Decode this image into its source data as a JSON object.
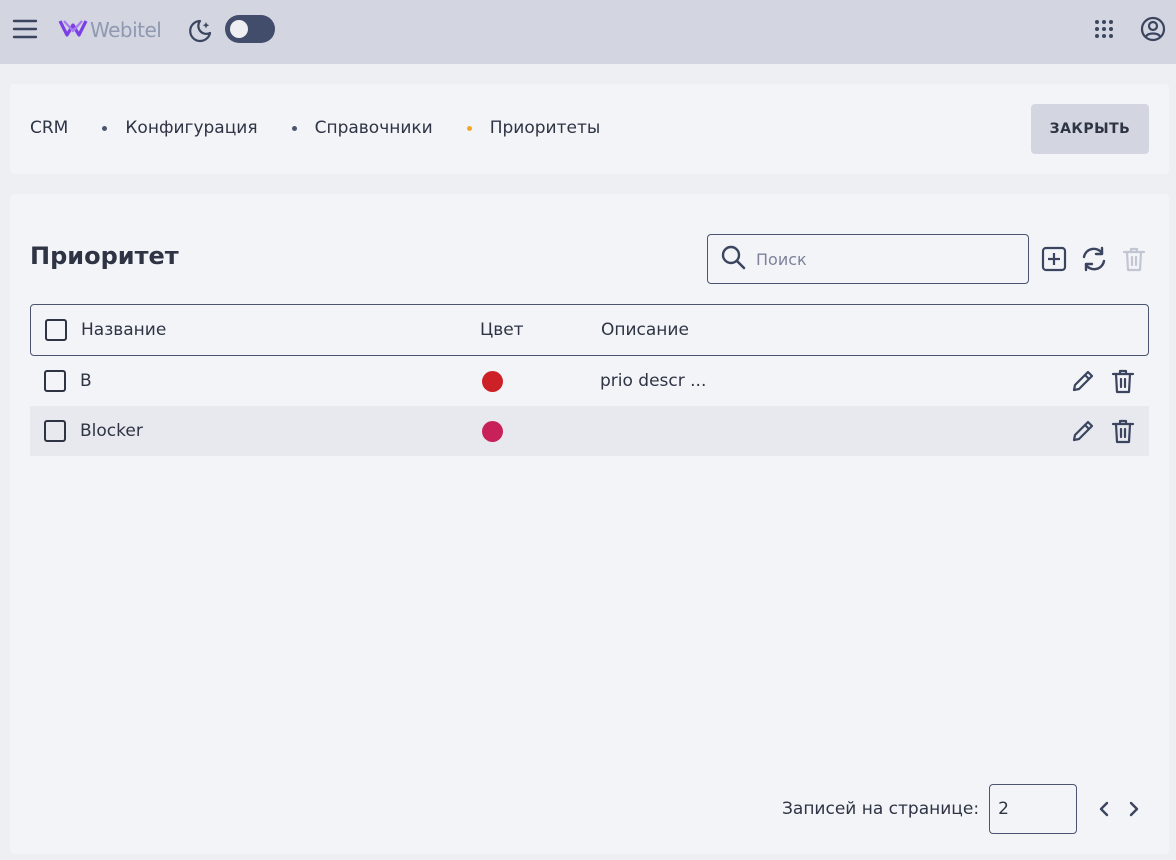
{
  "header": {
    "logo_text": "Webitel",
    "icons": [
      "menu-icon",
      "webitel-logo-icon",
      "theme-moon-icon",
      "apps-grid-icon",
      "account-icon"
    ],
    "theme_toggle_on": false
  },
  "breadcrumbs": [
    "CRM",
    "Конфигурация",
    "Справочники",
    "Приоритеты"
  ],
  "close_button": "ЗАКРЫТЬ",
  "page": {
    "title": "Приоритет",
    "search_placeholder": "Поиск"
  },
  "table": {
    "columns": [
      "Название",
      "Цвет",
      "Описание"
    ],
    "rows": [
      {
        "name": "B",
        "color": "#cc2127",
        "description": "prio descr ..."
      },
      {
        "name": "Blocker",
        "color": "#c8215a",
        "description": ""
      }
    ]
  },
  "pagination": {
    "per_page_label": "Записей на странице:",
    "per_page_value": "2"
  },
  "colors": {
    "accent": "#f5a623",
    "topbar": "#d3d6e0",
    "text": "#2e3444"
  }
}
